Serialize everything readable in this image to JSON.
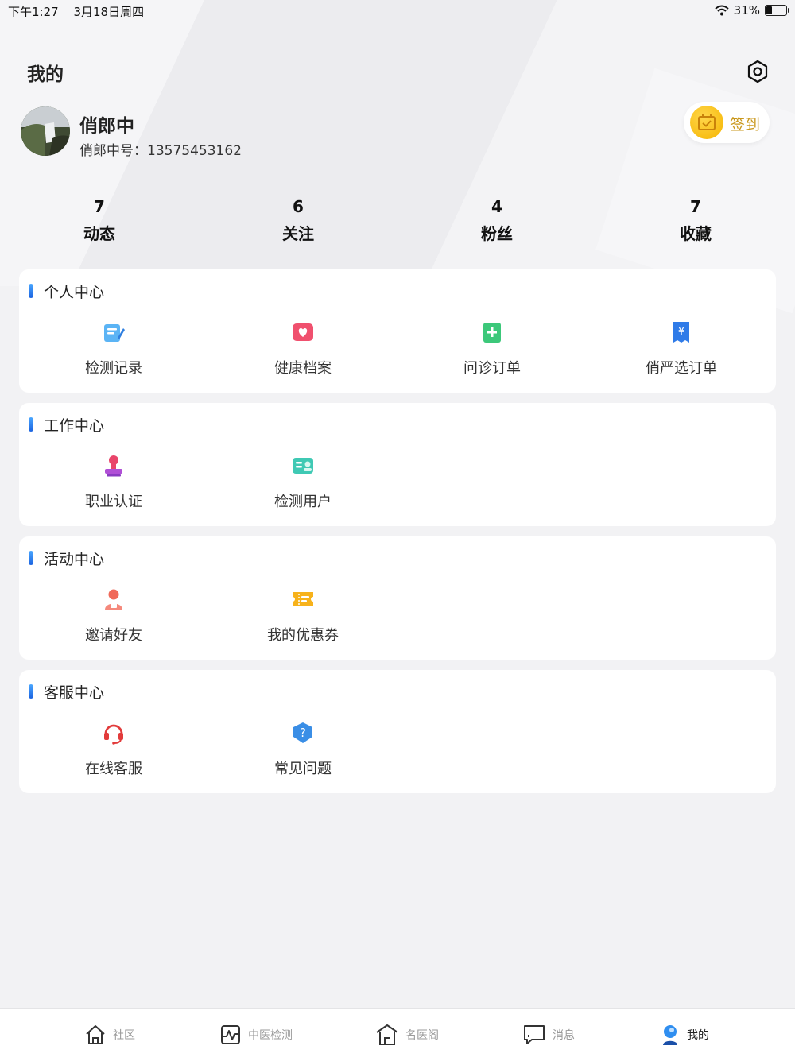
{
  "status_bar": {
    "time": "下午1:27",
    "date": "3月18日周四",
    "battery": "31%",
    "battery_level": 0.31
  },
  "header": {
    "title": "我的"
  },
  "profile": {
    "name": "俏郎中",
    "id_label": "俏郎中号：",
    "id_value": "13575453162",
    "checkin_label": "签到"
  },
  "stats": [
    {
      "count": "7",
      "label": "动态"
    },
    {
      "count": "6",
      "label": "关注"
    },
    {
      "count": "4",
      "label": "粉丝"
    },
    {
      "count": "7",
      "label": "收藏"
    }
  ],
  "sections": [
    {
      "title": "个人中心",
      "items": [
        {
          "label": "检测记录",
          "icon": "record-icon"
        },
        {
          "label": "健康档案",
          "icon": "health-file-icon"
        },
        {
          "label": "问诊订单",
          "icon": "consult-order-icon"
        },
        {
          "label": "俏严选订单",
          "icon": "shop-order-icon"
        }
      ]
    },
    {
      "title": "工作中心",
      "items": [
        {
          "label": "职业认证",
          "icon": "certification-icon"
        },
        {
          "label": "检测用户",
          "icon": "test-users-icon"
        }
      ]
    },
    {
      "title": "活动中心",
      "items": [
        {
          "label": "邀请好友",
          "icon": "invite-friend-icon"
        },
        {
          "label": "我的优惠券",
          "icon": "coupon-icon"
        }
      ]
    },
    {
      "title": "客服中心",
      "items": [
        {
          "label": "在线客服",
          "icon": "headset-icon"
        },
        {
          "label": "常见问题",
          "icon": "faq-icon"
        }
      ]
    }
  ],
  "tabbar": [
    {
      "label": "社区",
      "icon": "home-icon"
    },
    {
      "label": "中医检测",
      "icon": "pulse-icon"
    },
    {
      "label": "名医阁",
      "icon": "pavilion-icon"
    },
    {
      "label": "消息",
      "icon": "message-icon"
    },
    {
      "label": "我的",
      "icon": "profile-icon",
      "active": true
    }
  ],
  "colors": {
    "accent_blue": "#1b63e0",
    "checkin_gold": "#f5b400",
    "checkin_text": "#c9971b"
  }
}
